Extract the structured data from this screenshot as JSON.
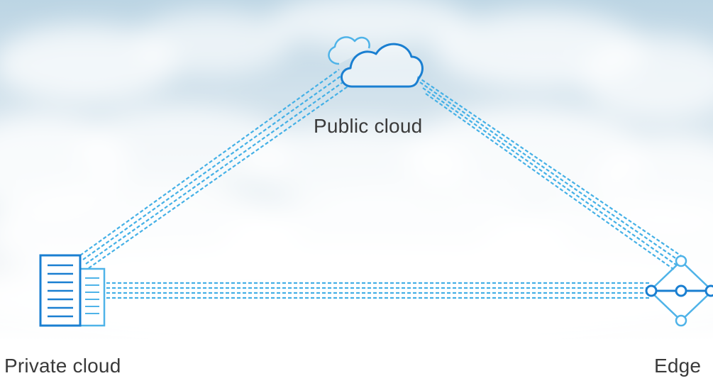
{
  "nodes": {
    "public_cloud": {
      "label": "Public cloud",
      "icon": "cloud-icon"
    },
    "private_cloud": {
      "label": "Private cloud",
      "icon": "server-building-icon"
    },
    "edge": {
      "label": "Edge",
      "icon": "edge-network-icon"
    }
  },
  "connections": [
    {
      "from": "private_cloud",
      "to": "public_cloud",
      "style": "dashed",
      "lines": 4
    },
    {
      "from": "public_cloud",
      "to": "edge",
      "style": "dashed",
      "lines": 4
    },
    {
      "from": "private_cloud",
      "to": "edge",
      "style": "dashed",
      "lines": 4
    }
  ],
  "colors": {
    "accent": "#1a7fd1",
    "accent_light": "#4fb3e8",
    "line": "#44b0e6",
    "text": "#3a3a3a",
    "sky": "#bcd5e4"
  }
}
